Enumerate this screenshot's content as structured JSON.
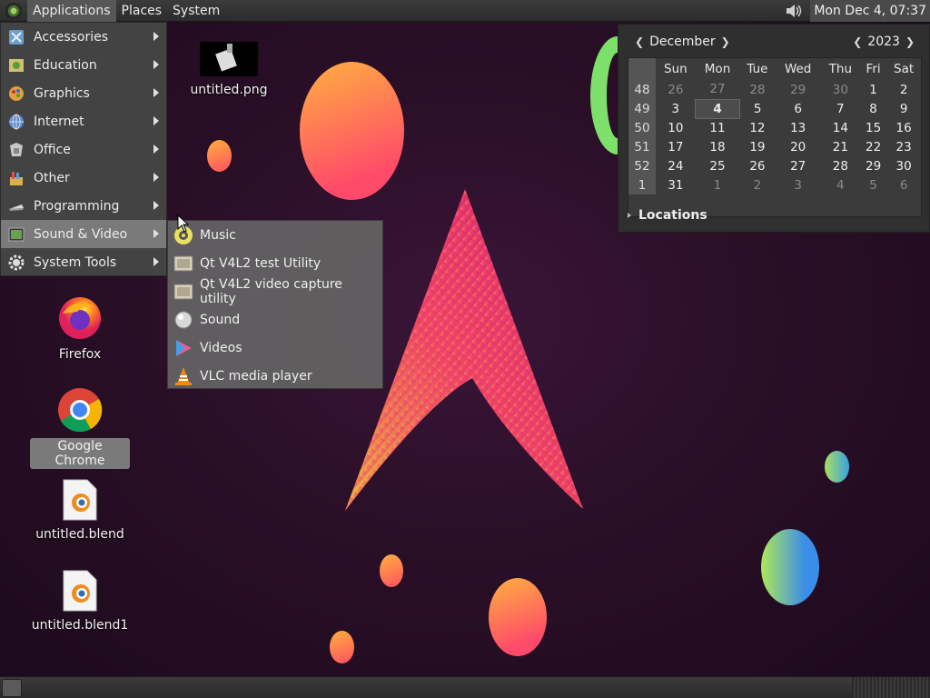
{
  "top_panel": {
    "menus": [
      "Applications",
      "Places",
      "System"
    ],
    "clock": "Mon Dec  4, 07:37"
  },
  "apps_menu": {
    "items": [
      {
        "label": "Accessories",
        "icon": "accessories-icon"
      },
      {
        "label": "Education",
        "icon": "education-icon"
      },
      {
        "label": "Graphics",
        "icon": "graphics-icon"
      },
      {
        "label": "Internet",
        "icon": "internet-icon"
      },
      {
        "label": "Office",
        "icon": "office-icon"
      },
      {
        "label": "Other",
        "icon": "other-icon"
      },
      {
        "label": "Programming",
        "icon": "programming-icon"
      },
      {
        "label": "Sound & Video",
        "icon": "sound-video-icon"
      },
      {
        "label": "System Tools",
        "icon": "system-tools-icon"
      }
    ],
    "highlighted_index": 7
  },
  "sub_menu": {
    "items": [
      {
        "label": "Music",
        "icon": "music-icon"
      },
      {
        "label": "Qt V4L2 test Utility",
        "icon": "qt-v4l2-icon"
      },
      {
        "label": "Qt V4L2 video capture utility",
        "icon": "qt-v4l2-capture-icon"
      },
      {
        "label": "Sound",
        "icon": "sound-icon"
      },
      {
        "label": "Videos",
        "icon": "videos-icon"
      },
      {
        "label": "VLC media player",
        "icon": "vlc-icon"
      }
    ]
  },
  "desktop": {
    "icons": [
      {
        "label": "untitled.png",
        "icon": "image-file-icon"
      },
      {
        "label": "Firefox",
        "icon": "firefox-icon"
      },
      {
        "label": "Google Chrome",
        "icon": "chrome-icon",
        "selected": true
      },
      {
        "label": "untitled.blend",
        "icon": "blender-file-icon"
      },
      {
        "label": "untitled.blend1",
        "icon": "blender-file-icon"
      }
    ]
  },
  "calendar": {
    "month": "December",
    "year": "2023",
    "weekdays": [
      "Sun",
      "Mon",
      "Tue",
      "Wed",
      "Thu",
      "Fri",
      "Sat"
    ],
    "weeks": [
      {
        "wk": "48",
        "days": [
          "26",
          "27",
          "28",
          "29",
          "30",
          "1",
          "2"
        ]
      },
      {
        "wk": "49",
        "days": [
          "3",
          "4",
          "5",
          "6",
          "7",
          "8",
          "9"
        ]
      },
      {
        "wk": "50",
        "days": [
          "10",
          "11",
          "12",
          "13",
          "14",
          "15",
          "16"
        ]
      },
      {
        "wk": "51",
        "days": [
          "17",
          "18",
          "19",
          "20",
          "21",
          "22",
          "23"
        ]
      },
      {
        "wk": "52",
        "days": [
          "24",
          "25",
          "26",
          "27",
          "28",
          "29",
          "30"
        ]
      },
      {
        "wk": "1",
        "days": [
          "31",
          "1",
          "2",
          "3",
          "4",
          "5",
          "6"
        ]
      }
    ],
    "locations_label": "Locations"
  }
}
